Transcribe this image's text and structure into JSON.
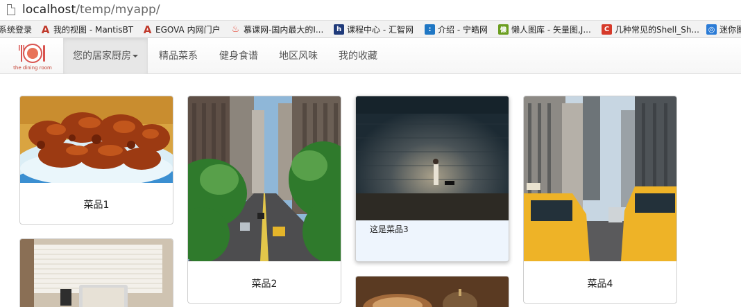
{
  "browser": {
    "url_host": "localhost",
    "url_path": "/temp/myapp/",
    "bookmarks": [
      {
        "label": "系统登录",
        "icon": "none",
        "color": ""
      },
      {
        "label": "我的视图 - MantisBT",
        "icon": "mantis-icon",
        "color": "#c0392b",
        "glyph": "A"
      },
      {
        "label": "EGOVA 内网门户",
        "icon": "egova-icon",
        "color": "#c0392b",
        "glyph": "A"
      },
      {
        "label": "慕课网-国内最大的I...",
        "icon": "imooc-icon",
        "color": "#e74c3c",
        "glyph": "♨"
      },
      {
        "label": "课程中心 - 汇智网",
        "icon": "hubwiz-icon",
        "color": "#1f3a7a",
        "glyph": "h"
      },
      {
        "label": "介绍 - 宁皓网",
        "icon": "ninghao-icon",
        "color": "#1f77c4",
        "glyph": ":"
      },
      {
        "label": "懒人图库 - 矢量图,J...",
        "icon": "lanrentuku-icon",
        "color": "#6b9e1f",
        "glyph": "懒"
      },
      {
        "label": "几种常见的Shell_Sh...",
        "icon": "csdn-icon",
        "color": "#d63a2a",
        "glyph": "C"
      },
      {
        "label": "迷你图",
        "icon": "globe-icon",
        "color": "#2a7bd6",
        "glyph": "◎"
      }
    ]
  },
  "navbar": {
    "brand_text": "the dining room",
    "items": [
      {
        "label": "您的居家厨房",
        "active": true,
        "dropdown": true
      },
      {
        "label": "精品菜系",
        "active": false
      },
      {
        "label": "健身食谱",
        "active": false
      },
      {
        "label": "地区风味",
        "active": false
      },
      {
        "label": "我的收藏",
        "active": false
      }
    ]
  },
  "cards": [
    {
      "caption": "菜品1",
      "image": "fried-food-photo"
    },
    {
      "caption": "菜品2",
      "image": "city-street-photo"
    },
    {
      "caption": "这是菜品3",
      "image": "wall-night-photo"
    },
    {
      "caption": "菜品4",
      "image": "taxi-street-photo"
    },
    {
      "caption": "",
      "image": "window-desk-photo"
    },
    {
      "caption": "",
      "image": "coffee-photo"
    }
  ]
}
